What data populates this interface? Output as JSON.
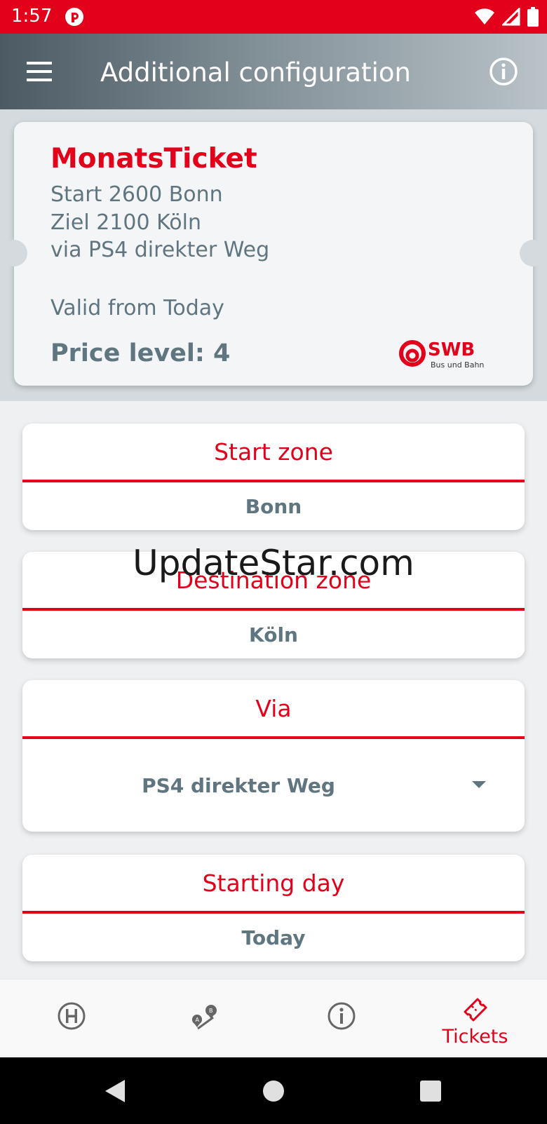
{
  "status_bar": {
    "time": "1:57",
    "icons": [
      "app-notification-icon",
      "wifi-icon",
      "signal-icon",
      "battery-icon"
    ]
  },
  "app_bar": {
    "title": "Additional configuration",
    "menu_icon": "hamburger-menu-icon",
    "info_icon": "info-icon"
  },
  "ticket": {
    "name": "MonatsTicket",
    "start": "Start 2600 Bonn",
    "destination": "Ziel 2100 Köln",
    "via": "via PS4 direkter Weg",
    "valid": "Valid from Today",
    "price_level": "Price level: 4",
    "logo_text": "SWB",
    "logo_subtext": "Bus und Bahn"
  },
  "form": {
    "start_zone": {
      "label": "Start zone",
      "value": "Bonn"
    },
    "destination_zone": {
      "label": "Destination zone",
      "value": "Köln"
    },
    "via": {
      "label": "Via",
      "value": "PS4 direkter Weg"
    },
    "starting_day": {
      "label": "Starting day",
      "value": "Today"
    }
  },
  "watermark": "UpdateStar.com",
  "bottom_nav": {
    "items": [
      {
        "icon": "station-h-icon",
        "label": ""
      },
      {
        "icon": "route-ab-icon",
        "label": ""
      },
      {
        "icon": "info-icon",
        "label": ""
      },
      {
        "icon": "ticket-icon",
        "label": "Tickets"
      }
    ],
    "active_color": "#e2001a"
  },
  "colors": {
    "brand_red": "#e2001a",
    "text_gray": "#5f7580"
  }
}
